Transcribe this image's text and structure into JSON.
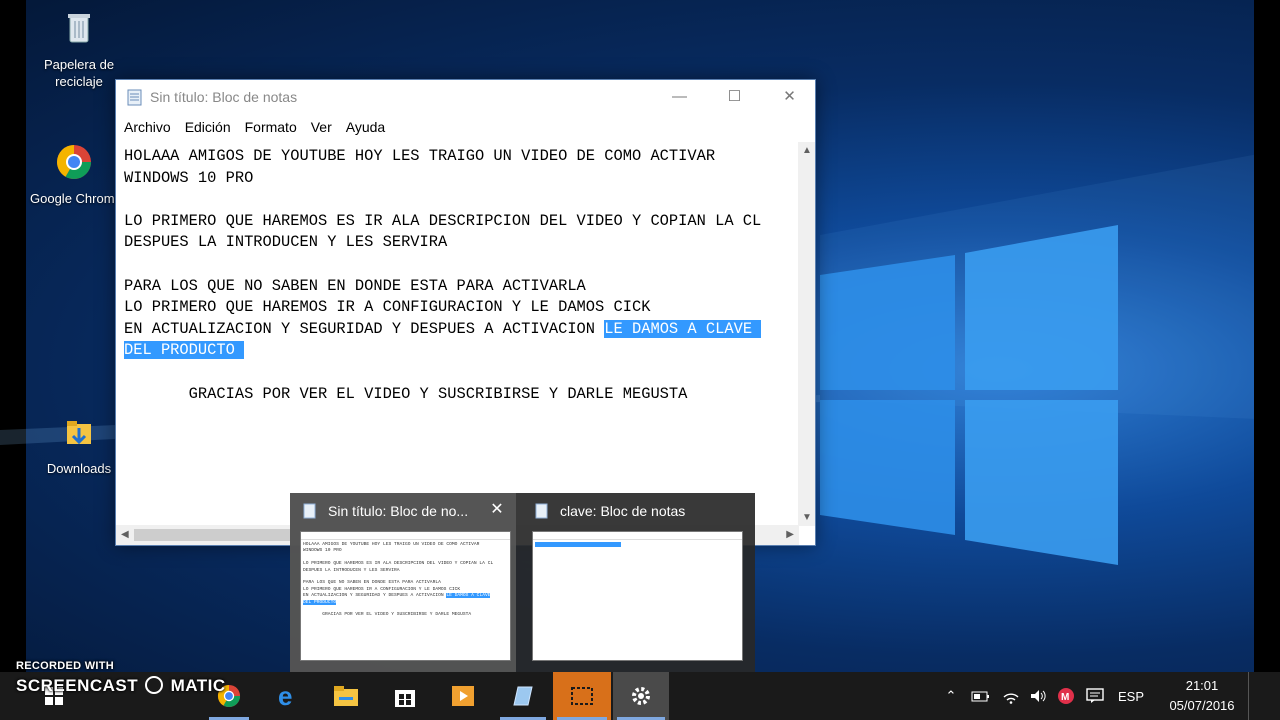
{
  "desktop": {
    "icons": [
      {
        "label": "Papelera de reciclaje",
        "icon": "recycle-bin-icon"
      },
      {
        "label": "Google Chrome",
        "icon": "chrome-icon"
      },
      {
        "label": "Downloads",
        "icon": "downloads-folder-icon"
      }
    ]
  },
  "notepad": {
    "title": "Sin título: Bloc de notas",
    "menu": [
      "Archivo",
      "Edición",
      "Formato",
      "Ver",
      "Ayuda"
    ],
    "text_before_selection": "HOLAAA AMIGOS DE YOUTUBE HOY LES TRAIGO UN VIDEO DE COMO ACTIVAR\nWINDOWS 10 PRO\n\nLO PRIMERO QUE HAREMOS ES IR ALA DESCRIPCION DEL VIDEO Y COPIAN LA CL\nDESPUES LA INTRODUCEN Y LES SERVIRA\n\nPARA LOS QUE NO SABEN EN DONDE ESTA PARA ACTIVARLA\nLO PRIMERO QUE HAREMOS IR A CONFIGURACION Y LE DAMOS CICK\nEN ACTUALIZACION Y SEGURIDAD Y DESPUES A ACTIVACION ",
    "selected_line1": "LE DAMOS A CLAVE ",
    "selected_line2": "DEL PRODUCTO ",
    "text_after_selection": "\n\n       GRACIAS POR VER EL VIDEO Y SUSCRIBIRSE Y DARLE MEGUSTA"
  },
  "preview": {
    "items": [
      {
        "title": "Sin título: Bloc de no...",
        "active": true
      },
      {
        "title": "clave: Bloc de notas",
        "active": false
      }
    ]
  },
  "taskbar": {
    "language": "ESP",
    "time": "21:01",
    "date": "05/07/2016"
  },
  "watermark": {
    "line1": "RECORDED WITH",
    "line2": "SCREENCAST",
    "line3": "MATIC"
  },
  "colors": {
    "selection": "#3399ff",
    "taskbar": "#1a1a1a",
    "accent": "#7fa8e0"
  }
}
